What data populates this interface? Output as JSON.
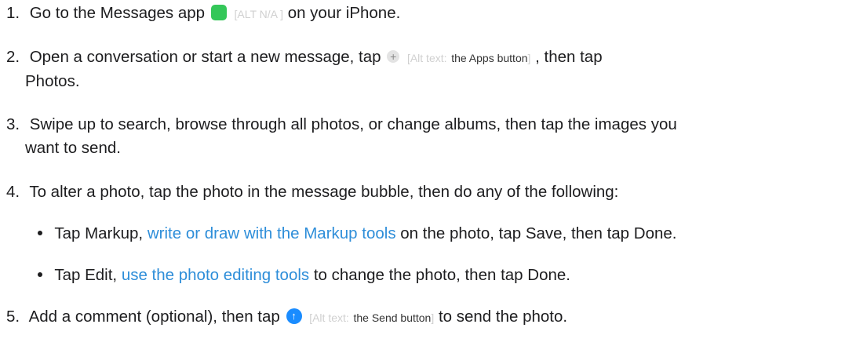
{
  "steps": [
    {
      "num": "1.",
      "parts": [
        "Go to the Messages app",
        "on your iPhone."
      ],
      "alt": "[ALT N/A ]",
      "icon": "messages-app-icon"
    },
    {
      "num": "2.",
      "before": "Open a conversation or start a new message, tap",
      "alt_prefix": "[Alt text:",
      "alt_text": "the Apps button",
      "alt_suffix": "]",
      "after": ", then tap",
      "line2": "Photos.",
      "icon": "plus-icon"
    },
    {
      "num": "3.",
      "line1": "Swipe up to search, browse through all photos, or change albums, then tap the images you",
      "line2": "want to send."
    },
    {
      "num": "4.",
      "text": "To alter a photo, tap the photo in the message bubble, then do any of the following:"
    },
    {
      "num": "5.",
      "before": "Add a comment (optional), then tap",
      "alt_prefix": "[Alt text:",
      "alt_text": "the Send button",
      "alt_suffix": "]",
      "after": "to send the photo.",
      "icon": "send-arrow-icon"
    }
  ],
  "bullets": [
    {
      "before": "Tap Markup,",
      "link": "write or draw with the Markup tools",
      "after": "on the photo, tap Save, then tap Done."
    },
    {
      "before": "Tap Edit,",
      "link": "use the photo editing tools",
      "after": "to change the photo, then tap Done."
    }
  ],
  "colors": {
    "text": "#1d1d1f",
    "link": "#2e8ed9",
    "messages_green": "#34c759",
    "send_blue": "#1a8cff"
  }
}
